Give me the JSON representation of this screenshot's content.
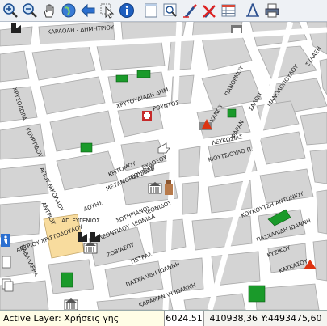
{
  "toolbar": {
    "buttons": [
      {
        "name": "zoom-in-icon"
      },
      {
        "name": "zoom-out-icon"
      },
      {
        "name": "pan-hand-icon"
      },
      {
        "name": "globe-icon"
      },
      {
        "name": "back-arrow-icon"
      },
      {
        "name": "select-pointer-icon"
      },
      {
        "name": "info-icon"
      },
      {
        "name": "blank-page-icon"
      },
      {
        "name": "zoom-window-icon"
      },
      {
        "name": "draw-tool-icon"
      },
      {
        "name": "erase-tool-icon"
      },
      {
        "name": "table-icon"
      },
      {
        "name": "measure-icon"
      },
      {
        "name": "print-icon"
      }
    ]
  },
  "map": {
    "street_labels": [
      "ΚΑΡΑΟΛΗ - ΔΗΜΗΤΡΙΟΥ",
      "ΧΡΥΣΟΛΩΡΑ",
      "ΧΡΥΣΟΥΔΙΑΔΗ ΔΗΜ.",
      "ΡΟΥΝΤΟΣ",
      "ΠΑΝΟΡΜΟΥ",
      "ΜΑΝΟΛΟΠΟΥΛΟΥ",
      "ΣΥΛΑΞΗ",
      "ΣΑΛΩΝ",
      "ΧΑΝΟΥ",
      "ΦΑΡΑΝ",
      "ΛΕΥΚΩΣΙΑΣ",
      "ΚΙΟΥΤΣΙΟΥΛΟ Π.",
      "ΑΓΙΟΥ ΝΙΚΟΛΑΟΥ",
      "ΚΟΥΡΤΙΔΟΥ",
      "ΚΡΙΤΟΜΟΥ",
      "ΜΕΤΑΜΟΡΦΩΣΕΩΣ",
      "ΣΟΥΤΣΟΥ",
      "ΕΥΔΟΞΟΥ",
      "ΣΩΤΗΡΙΑΝΟΥ",
      "ΛΕΟΝΙΔΟΥ",
      "ΑΓ. ΕΥΓΕΝΙΟΣ",
      "ΑΝΤΡΙΟΥ",
      "ΚΟΥΚΟΥΤΣΗ ΑΝΤΩΝΙΟΥ",
      "ΛΕΟΝΤΙΔΟΥ ΛΕΩΝΙΔΑ",
      "ΑΝΤΡΙΟΥ ΧΡΙΣΤΟΔΟΥΛΟΥ",
      "ΚΑΒΑΛΛΕΡΑ",
      "ΖΟΒΙΑΣΟΥ",
      "ΠΕΤΡΑΣ",
      "ΠΑΣΧΑΛΙΔΗ ΙΩΑΝΝΗ",
      "ΠΑΣΧΑΛΙΔΗ ΙΩΑΝΝΗ",
      "ΚΥΖΙΚΟΥ",
      "ΚΑΥΚΑΣΟΥ",
      "ΚΑΡΑΜΑΝΛΗ ΙΩΑΝΝΗ",
      "ΛΟΥΗΣ"
    ]
  },
  "status": {
    "active_layer": "Active Layer: Χρήσεις γης",
    "scale": "6024.51",
    "x": "410938,36",
    "y": "Y:4493475,60"
  }
}
